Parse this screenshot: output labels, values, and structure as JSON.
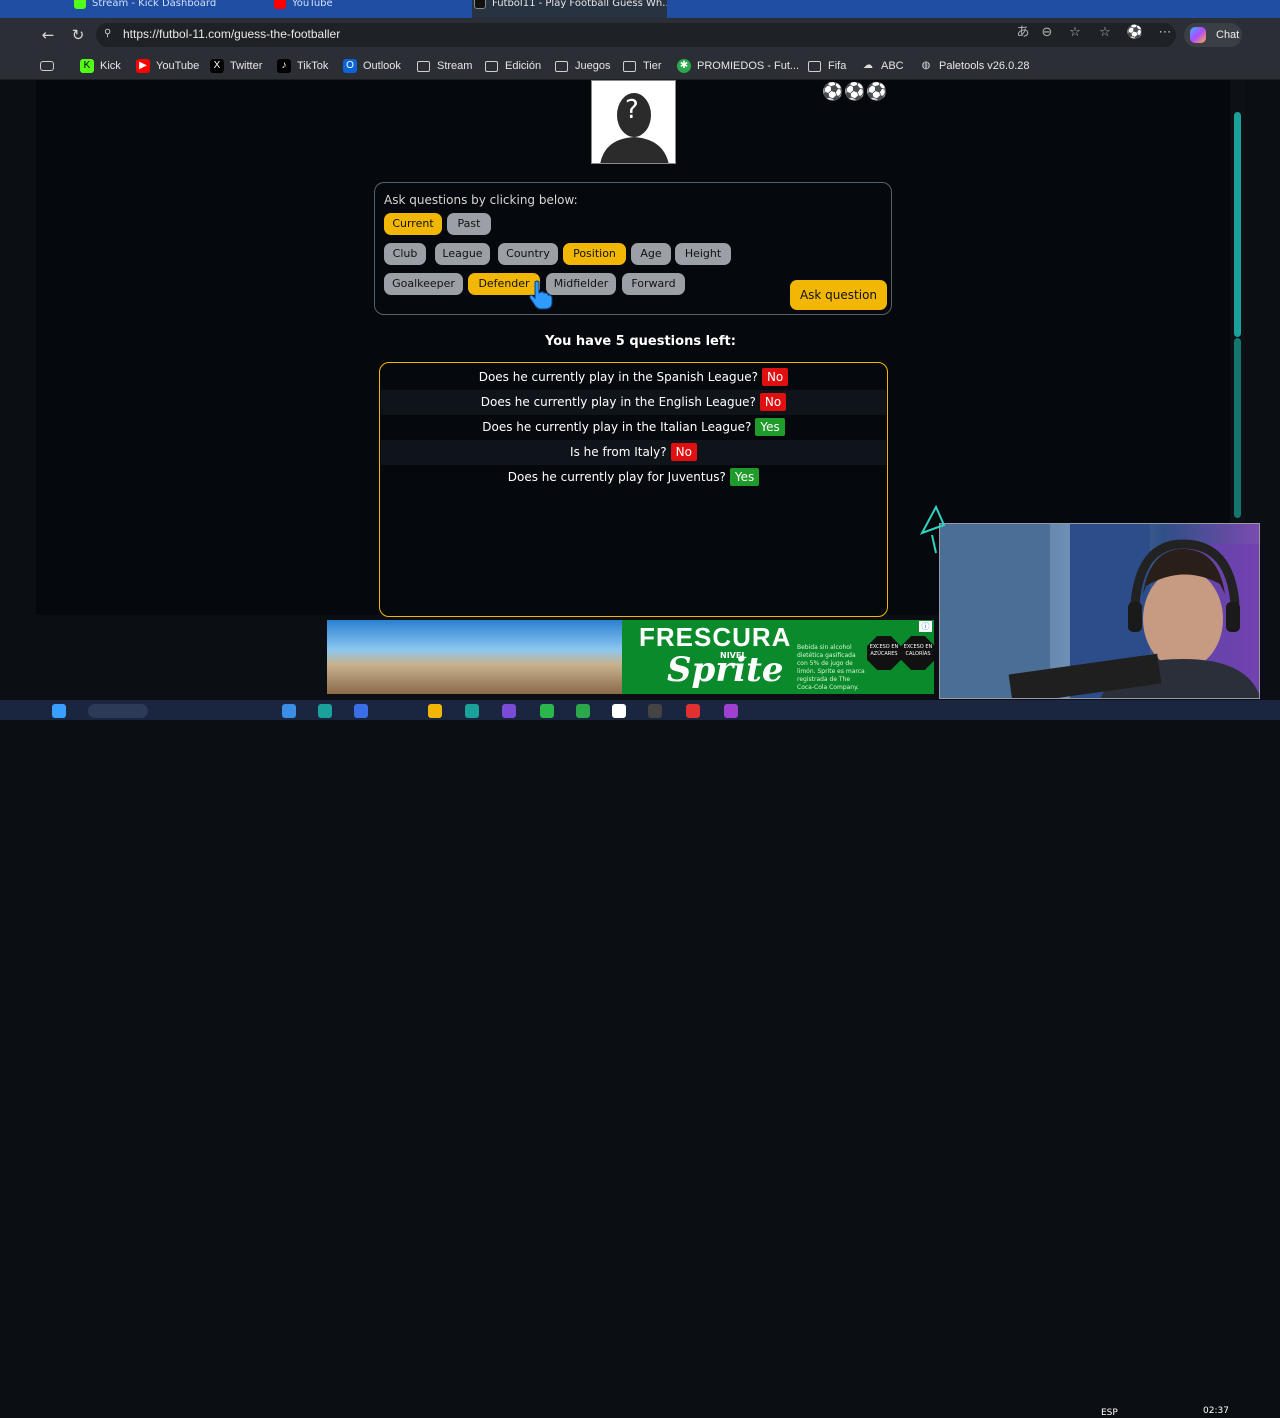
{
  "tabs": [
    {
      "label": "Stream - Kick Dashboard",
      "active": false
    },
    {
      "label": "YouTube",
      "active": false
    },
    {
      "label": "Futbol11 - Play Football Guess Wh...",
      "active": true
    }
  ],
  "address": {
    "url": "https://futbol-11.com/guess-the-footballer"
  },
  "browser": {
    "chat_label": "Chat"
  },
  "bookmarks": [
    {
      "label": "Kick",
      "icon": "kick-icon",
      "color": "#53fc18"
    },
    {
      "label": "YouTube",
      "icon": "youtube-icon",
      "color": "#ff0000"
    },
    {
      "label": "Twitter",
      "icon": "x-icon",
      "color": "#000000"
    },
    {
      "label": "TikTok",
      "icon": "tiktok-icon",
      "color": "#000000"
    },
    {
      "label": "Outlook",
      "icon": "outlook-icon",
      "color": "#0a64d6"
    },
    {
      "label": "Stream",
      "icon": "folder-icon"
    },
    {
      "label": "Edición",
      "icon": "folder-icon"
    },
    {
      "label": "Juegos",
      "icon": "folder-icon"
    },
    {
      "label": "Tier",
      "icon": "folder-icon"
    },
    {
      "label": "PROMIEDOS - Fut...",
      "icon": "promiedos-icon",
      "color": "#2aa84a"
    },
    {
      "label": "Fifa",
      "icon": "folder-icon"
    },
    {
      "label": "ABC",
      "icon": "abc-icon"
    },
    {
      "label": "Paletools v26.0.28",
      "icon": "globe-icon"
    }
  ],
  "game": {
    "avatar_mark": "?",
    "lives": "⚽⚽⚽",
    "prompt": "Ask questions by clicking below:",
    "time_filters": [
      {
        "label": "Current",
        "selected": true
      },
      {
        "label": "Past",
        "selected": false
      }
    ],
    "categories": [
      {
        "label": "Club",
        "selected": false
      },
      {
        "label": "League",
        "selected": false
      },
      {
        "label": "Country",
        "selected": false
      },
      {
        "label": "Position",
        "selected": true
      },
      {
        "label": "Age",
        "selected": false
      },
      {
        "label": "Height",
        "selected": false
      }
    ],
    "options": [
      {
        "label": "Goalkeeper",
        "selected": false
      },
      {
        "label": "Defender",
        "selected": true
      },
      {
        "label": "Midfielder",
        "selected": false
      },
      {
        "label": "Forward",
        "selected": false
      }
    ],
    "ask_label": "Ask question",
    "questions_left": "You have 5 questions left:",
    "history": [
      {
        "q": "Does he currently play in the Spanish League?",
        "a": "No"
      },
      {
        "q": "Does he currently play in the English League?",
        "a": "No"
      },
      {
        "q": "Does he currently play in the Italian League?",
        "a": "Yes"
      },
      {
        "q": "Is he from Italy?",
        "a": "No"
      },
      {
        "q": "Does he currently play for Juventus?",
        "a": "Yes"
      }
    ]
  },
  "ad": {
    "headline": "FRESCURA",
    "subline": "NIVEL",
    "brand": "Sprite",
    "fine_print": "Bebida sin alcohol dietética gasificada con 5% de jugo de limón. Sprite es marca registrada de The Coca-Cola Company.",
    "warning_1": "EXCESO EN AZÚCARES",
    "warning_2": "EXCESO EN CALORÍAS"
  },
  "taskbar": {
    "lang": "ESP",
    "time": "02:37"
  }
}
